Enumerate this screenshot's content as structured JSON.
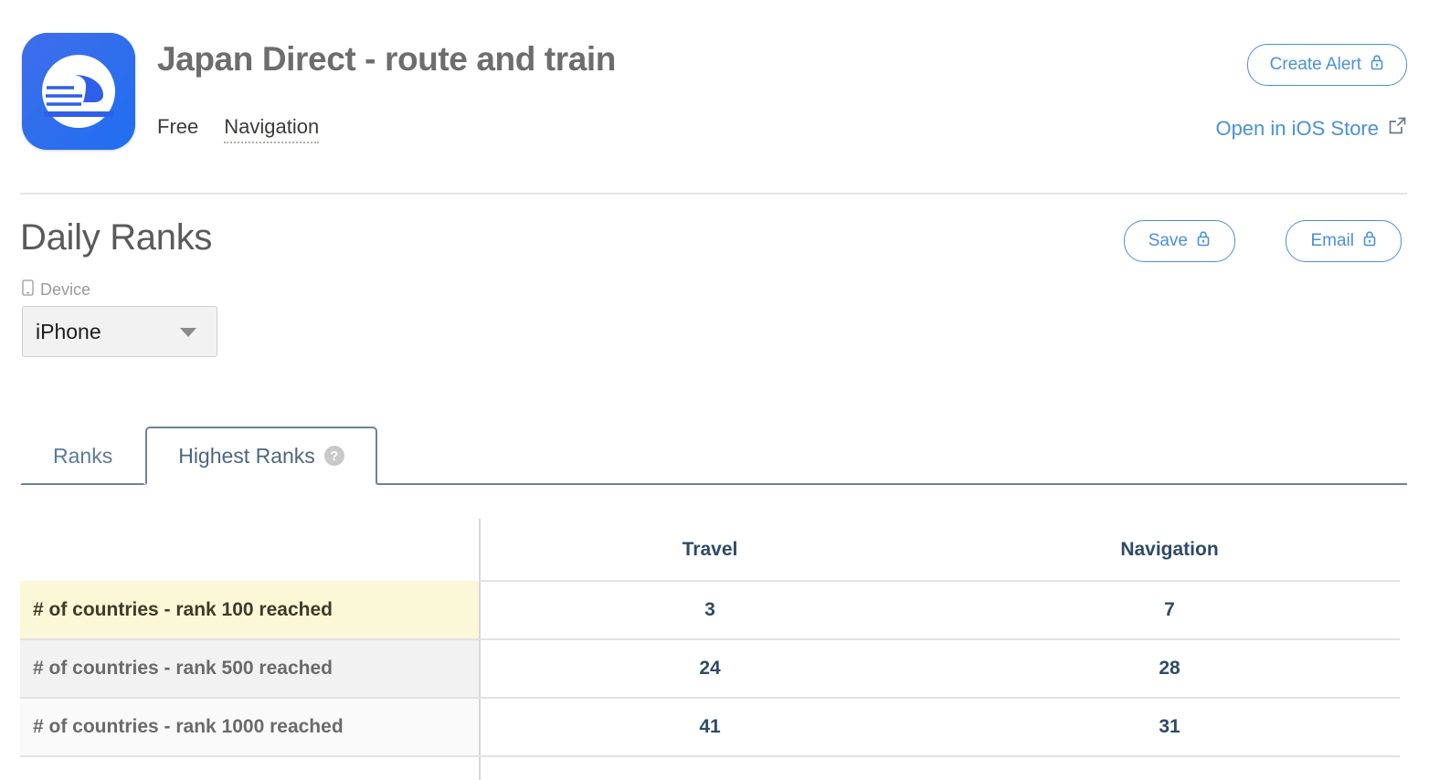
{
  "app": {
    "title": "Japan Direct - route and train",
    "price": "Free",
    "category": "Navigation",
    "icon_name": "bullet-train-app-icon",
    "create_alert_label": "Create Alert",
    "store_link_label": "Open in iOS Store"
  },
  "section": {
    "title": "Daily Ranks",
    "save_label": "Save",
    "email_label": "Email"
  },
  "filters": {
    "device_label": "Device",
    "device_value": "iPhone"
  },
  "tabs": [
    {
      "label": "Ranks",
      "active": false,
      "has_help": false
    },
    {
      "label": "Highest Ranks",
      "active": true,
      "has_help": true
    }
  ],
  "table": {
    "columns": [
      "",
      "Travel",
      "Navigation"
    ],
    "rows": [
      {
        "label": "# of countries - rank 100 reached",
        "travel": "3",
        "navigation": "7",
        "style": "hl"
      },
      {
        "label": "# of countries - rank 500 reached",
        "travel": "24",
        "navigation": "28",
        "style": "alt"
      },
      {
        "label": "# of countries - rank 1000 reached",
        "travel": "41",
        "navigation": "31",
        "style": "alt2"
      }
    ]
  },
  "colors": {
    "accent_blue": "#4a90d9",
    "tab_border": "#6a83a0",
    "value_navy": "#2e4a66",
    "highlight_yellow": "#fbf8d8",
    "icon_gradient_start": "#3f6dea",
    "icon_gradient_end": "#1f6ff0"
  }
}
